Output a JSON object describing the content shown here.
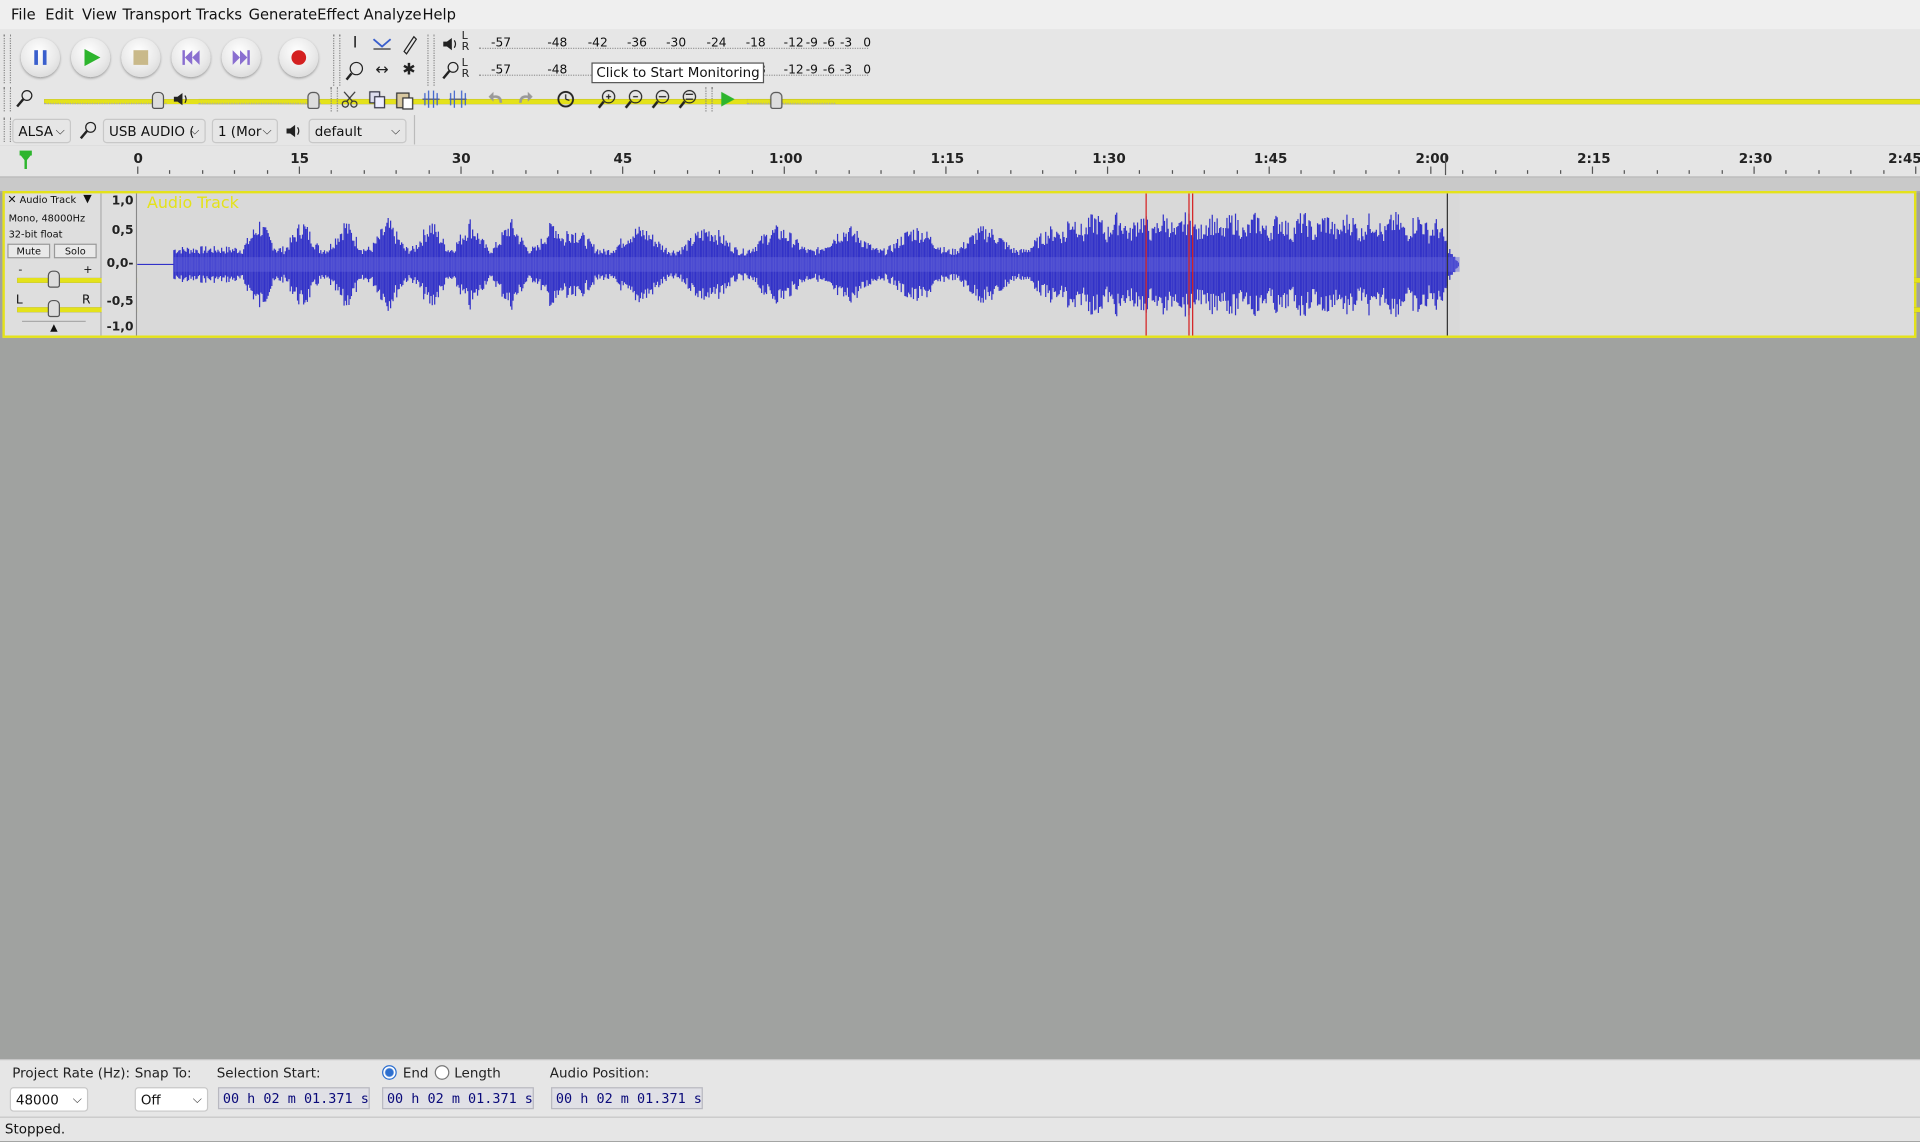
{
  "menu": [
    "File",
    "Edit",
    "View",
    "Transport",
    "Tracks",
    "Generate",
    "Effect",
    "Analyze",
    "Help"
  ],
  "meters": {
    "play_lr": "L\nR",
    "play_ticks": [
      "-57",
      "-48",
      "-42",
      "-36",
      "-30",
      "-24",
      "-18",
      "-12",
      "-9",
      "-6",
      "-3",
      "0"
    ],
    "rec_lr": "L\nR",
    "rec_ticks_left": [
      "-57",
      "-48"
    ],
    "rec_ticks_right": [
      "-12",
      "-9",
      "-6",
      "-3",
      "0"
    ],
    "rec_partial": "8"
  },
  "tooltip": "Click to Start Monitoring",
  "device": {
    "host": "ALSA",
    "rec_device": "USB AUDIO (",
    "channels": "1 (Mor",
    "play_device": "default"
  },
  "ruler": [
    "0",
    "15",
    "30",
    "45",
    "1:00",
    "1:15",
    "1:30",
    "1:45",
    "2:00",
    "2:15",
    "2:30",
    "2:45"
  ],
  "track": {
    "name": "Audio Track",
    "format": "Mono, 48000Hz",
    "bit_depth": "32-bit float",
    "mute": "Mute",
    "solo": "Solo",
    "gain_minus": "-",
    "gain_plus": "+",
    "pan_left": "L",
    "pan_right": "R",
    "vscale": [
      "1,0",
      "0,5",
      "0,0-",
      "-0,5",
      "-1,0"
    ],
    "label": "Audio Track"
  },
  "selection_bar": {
    "project_rate_label": "Project Rate (Hz):",
    "project_rate": "48000",
    "snap_label": "Snap To:",
    "snap_value": "Off",
    "sel_start_label": "Selection Start:",
    "end_label": "End",
    "length_label": "Length",
    "end_selected": true,
    "audio_pos_label": "Audio Position:",
    "sel_start": "00 h 02 m 01.371 s",
    "sel_end": "00 h 02 m 01.371 s",
    "audio_pos": "00 h 02 m 01.371 s"
  },
  "status": "Stopped.",
  "colors": {
    "waveform": "#3232c8",
    "track_border": "#e4e21a",
    "cursor": "#d42020"
  }
}
